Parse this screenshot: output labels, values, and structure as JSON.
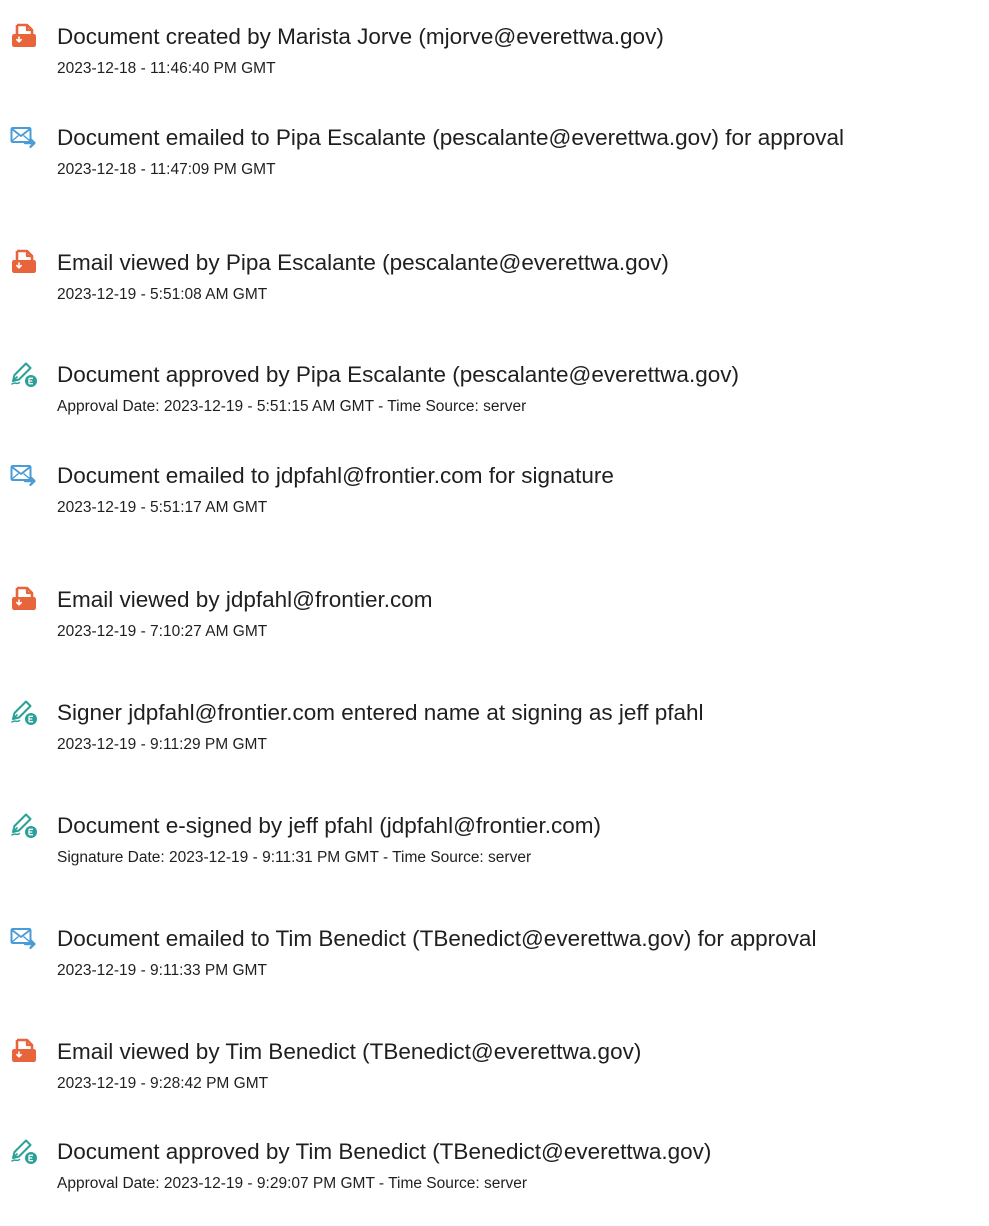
{
  "icon_colors": {
    "document-icon": "#e8653c",
    "email-icon": "#4a9bd6",
    "signature-icon": "#2aa198"
  },
  "events": [
    {
      "icon": "document-icon",
      "title": "Document created by Marista Jorve (mjorve@everettwa.gov)",
      "date": "2023-12-18 - 11:46:40 PM GMT"
    },
    {
      "icon": "email-icon",
      "title": "Document emailed to Pipa Escalante (pescalante@everettwa.gov) for approval",
      "date": "2023-12-18 - 11:47:09 PM GMT"
    },
    {
      "icon": "document-icon",
      "title": "Email viewed by Pipa Escalante (pescalante@everettwa.gov)",
      "date": "2023-12-19 - 5:51:08 AM GMT"
    },
    {
      "icon": "signature-icon",
      "title": "Document approved by Pipa Escalante (pescalante@everettwa.gov)",
      "date": "Approval Date: 2023-12-19 - 5:51:15 AM GMT - Time Source: server"
    },
    {
      "icon": "email-icon",
      "title": "Document emailed to jdpfahl@frontier.com for signature",
      "date": "2023-12-19 - 5:51:17 AM GMT"
    },
    {
      "icon": "document-icon",
      "title": "Email viewed by jdpfahl@frontier.com",
      "date": "2023-12-19 - 7:10:27 AM GMT"
    },
    {
      "icon": "signature-icon",
      "title": "Signer jdpfahl@frontier.com entered name at signing as jeff pfahl",
      "date": "2023-12-19 - 9:11:29 PM GMT"
    },
    {
      "icon": "signature-icon",
      "title": "Document e-signed by jeff pfahl (jdpfahl@frontier.com)",
      "date": "Signature Date: 2023-12-19 - 9:11:31 PM GMT - Time Source: server"
    },
    {
      "icon": "email-icon",
      "title": "Document emailed to Tim Benedict (TBenedict@everettwa.gov) for approval",
      "date": "2023-12-19 - 9:11:33 PM GMT"
    },
    {
      "icon": "document-icon",
      "title": "Email viewed by Tim Benedict (TBenedict@everettwa.gov)",
      "date": "2023-12-19 - 9:28:42 PM GMT"
    },
    {
      "icon": "signature-icon",
      "title": "Document approved by Tim Benedict (TBenedict@everettwa.gov)",
      "date": "Approval Date: 2023-12-19 - 9:29:07 PM GMT - Time Source: server"
    }
  ]
}
